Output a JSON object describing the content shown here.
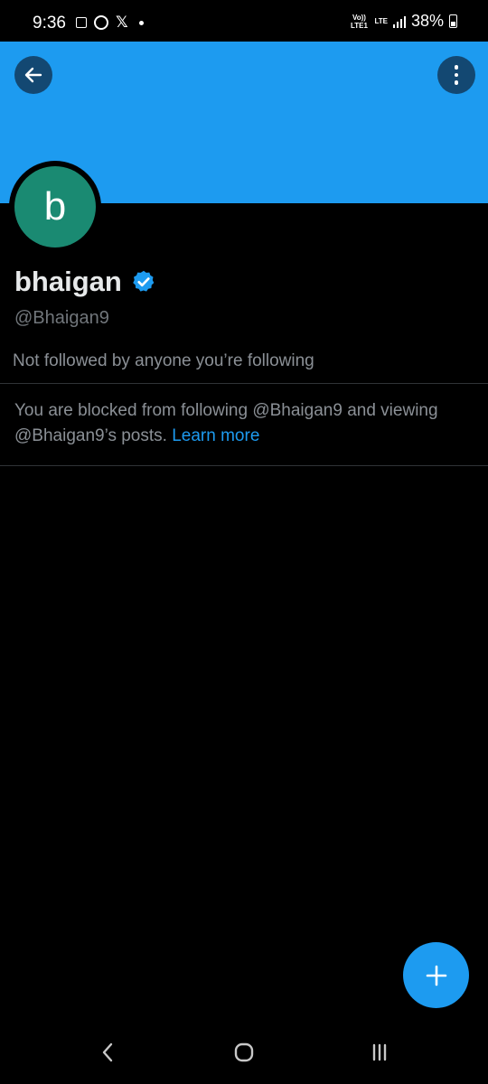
{
  "status_bar": {
    "time": "9:36",
    "network_volte": "Vo)) LTE1",
    "network_lte": "LTE",
    "battery_percent": "38%",
    "battery_level": 0.38,
    "icons": [
      "message-icon",
      "whatsapp-icon",
      "x-icon",
      "notification-dot",
      "signal-icon",
      "battery-icon"
    ]
  },
  "header": {
    "banner_color": "#1d9bf0",
    "back_icon": "arrow-left-icon",
    "more_icon": "more-vertical-icon"
  },
  "profile": {
    "avatar_letter": "b",
    "avatar_color": "#1a8a72",
    "display_name": "bhaigan",
    "verified_icon": "verified-badge-icon",
    "handle": "@Bhaigan9",
    "follow_context": "Not followed by anyone you’re following"
  },
  "blocked": {
    "message": "You are blocked from following @Bhaigan9 and viewing @Bhaigan9’s posts.",
    "learn_more": "Learn more",
    "link_color": "#1d9bf0"
  },
  "fab": {
    "icon": "plus-icon"
  },
  "nav_bar": {
    "back_icon": "nav-back-icon",
    "home_icon": "nav-home-icon",
    "recents_icon": "nav-recents-icon"
  }
}
